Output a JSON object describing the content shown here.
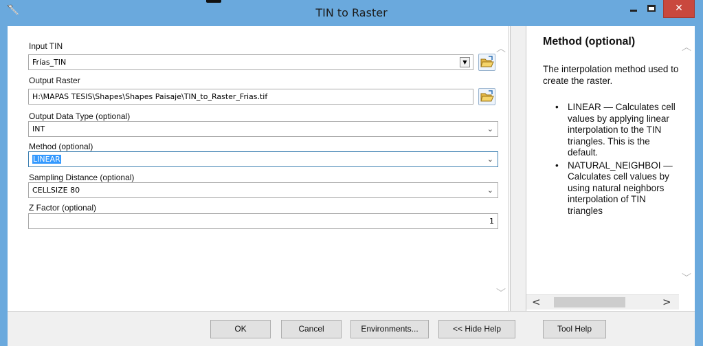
{
  "window": {
    "title": "TIN to Raster",
    "close_glyph": "✕"
  },
  "form": {
    "input_tin": {
      "label": "Input TIN",
      "value": "Frías_TIN"
    },
    "output_raster": {
      "label": "Output Raster",
      "value": "H:\\MAPAS TESIS\\Shapes\\Shapes Paisaje\\TIN_to_Raster_Frias.tif"
    },
    "output_data_type": {
      "label": "Output Data Type (optional)",
      "value": "INT"
    },
    "method": {
      "label": "Method (optional)",
      "value": "LINEAR"
    },
    "sampling_distance": {
      "label": "Sampling Distance (optional)",
      "value": "CELLSIZE  80"
    },
    "z_factor": {
      "label": "Z Factor (optional)",
      "value": "1"
    }
  },
  "help": {
    "title": "Method (optional)",
    "description": "The interpolation method used to create the raster.",
    "items": [
      "LINEAR — Calculates cell values by applying linear interpolation to the TIN triangles. This is the default.",
      "NATURAL_NEIGHBOI —Calculates cell values by using natural neighbors interpolation of TIN triangles"
    ]
  },
  "buttons": {
    "ok": "OK",
    "cancel": "Cancel",
    "environments": "Environments...",
    "hide_help": "<< Hide Help",
    "tool_help": "Tool Help"
  },
  "icons": {
    "tool": "hammer-icon",
    "browse": "folder-open-icon",
    "dropdown": "chevron-down-icon"
  },
  "colors": {
    "titlebar": "#6aa9dd",
    "close_button": "#c9483e",
    "selection": "#3399ff"
  }
}
